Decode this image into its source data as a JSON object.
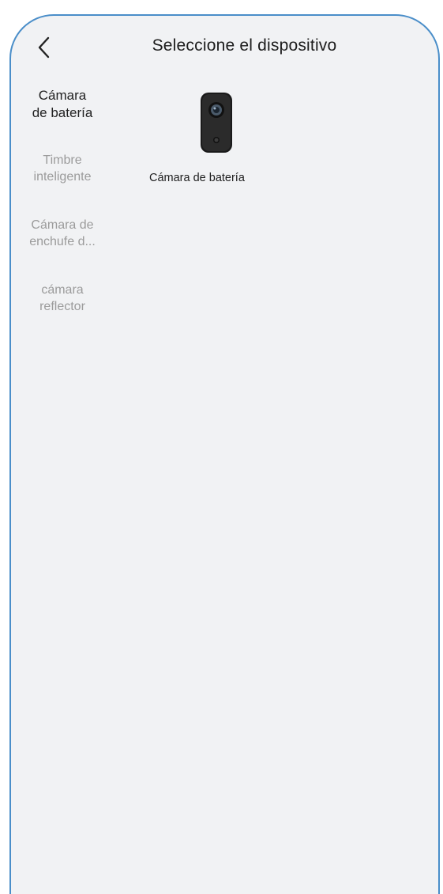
{
  "header": {
    "title": "Seleccione el dispositivo",
    "back_icon": "chevron-left-icon"
  },
  "categories": [
    {
      "line1": "Cámara",
      "line2": "de batería",
      "active": true
    },
    {
      "line1": "Timbre",
      "line2": "inteligente",
      "active": false
    },
    {
      "line1": "Cámara de",
      "line2": "enchufe d...",
      "active": false
    },
    {
      "line1": "cámara",
      "line2": "reflector",
      "active": false
    }
  ],
  "devices": [
    {
      "label": "Cámara de batería",
      "icon": "battery-camera-icon"
    }
  ],
  "colors": {
    "background": "#f1f2f4",
    "frame_border": "#4a8ec9",
    "active_text": "#222222",
    "inactive_text": "#9b9b9b"
  }
}
